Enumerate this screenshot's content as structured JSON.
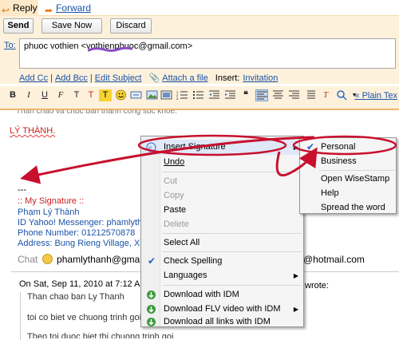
{
  "tabs": {
    "reply": "Reply",
    "forward": "Forward"
  },
  "actions": {
    "send": "Send",
    "save_now": "Save Now",
    "discard": "Discard"
  },
  "compose": {
    "to_label": "To:",
    "to_value": "phuoc vothien <vothienphuoc@gmail.com>",
    "add_cc": "Add Cc",
    "add_bcc": "Add Bcc",
    "edit_subject": "Edit Subject",
    "attach": "Attach a file",
    "insert_label": "Insert:",
    "invitation": "Invitation",
    "plain_text": "« Plain Tex"
  },
  "editor": {
    "name": "LÝ THÀNH.",
    "sig_dashes": "---",
    "sig_title": ":: My Signature ::",
    "sig_name": "Phạm Lý Thành",
    "sig_yahoo": "ID Yahoo! Messenger: phamlytha",
    "sig_phone": "Phone Number: 01212570878",
    "sig_address": "Address: Bung Rieng Village, Xuy",
    "chat_label": "Chat",
    "chat_id": "phamlythanh@gmail",
    "hotmail": "@hotmail.com",
    "on_sat": "On Sat, Sep 11, 2010 at 7:12 AM",
    "wrote": "wrote:",
    "quote_1": "Than chao ban Ly Thanh",
    "quote_2": "toi co biet ve chuong trinh goi",
    "quote_3": "Theo toi duoc biet thi chuong trinh goi"
  },
  "context_menu": {
    "insert_signature": "Insert Signature",
    "undo": "Undo",
    "cut": "Cut",
    "copy": "Copy",
    "paste": "Paste",
    "delete": "Delete",
    "select_all": "Select All",
    "check_spelling": "Check Spelling",
    "languages": "Languages",
    "download_idm": "Download with IDM",
    "download_flv": "Download FLV video with IDM",
    "download_all": "Download all links with IDM"
  },
  "submenu": {
    "personal": "Personal",
    "business": "Business",
    "open_wisestamp": "Open WiseStamp",
    "help": "Help",
    "spread": "Spread the word"
  },
  "colors": {
    "accent": "#e57c1a",
    "link": "#1a53a8",
    "annotation": "#c8102e",
    "sig_red": "#cc1f1f"
  },
  "icons": [
    "reply-icon",
    "forward-icon",
    "paperclip-icon",
    "invitation-icon",
    "wisestamp-icon",
    "idm-icon",
    "checkmark-icon"
  ]
}
